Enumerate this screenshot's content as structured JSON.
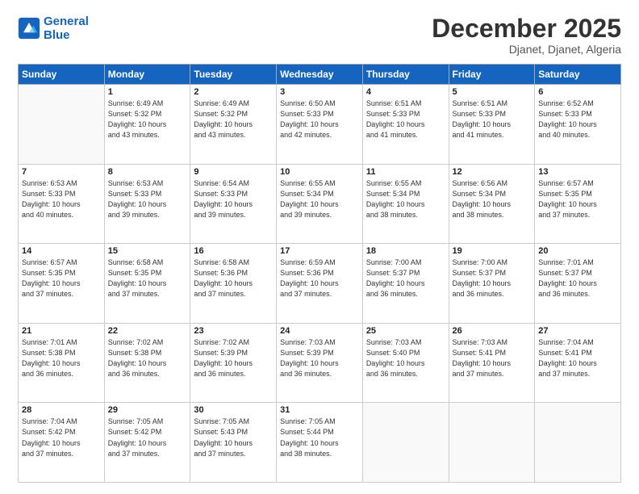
{
  "header": {
    "logo_line1": "General",
    "logo_line2": "Blue",
    "month": "December 2025",
    "location": "Djanet, Djanet, Algeria"
  },
  "weekdays": [
    "Sunday",
    "Monday",
    "Tuesday",
    "Wednesday",
    "Thursday",
    "Friday",
    "Saturday"
  ],
  "weeks": [
    [
      {
        "day": "",
        "info": ""
      },
      {
        "day": "1",
        "info": "Sunrise: 6:49 AM\nSunset: 5:32 PM\nDaylight: 10 hours\nand 43 minutes."
      },
      {
        "day": "2",
        "info": "Sunrise: 6:49 AM\nSunset: 5:32 PM\nDaylight: 10 hours\nand 43 minutes."
      },
      {
        "day": "3",
        "info": "Sunrise: 6:50 AM\nSunset: 5:33 PM\nDaylight: 10 hours\nand 42 minutes."
      },
      {
        "day": "4",
        "info": "Sunrise: 6:51 AM\nSunset: 5:33 PM\nDaylight: 10 hours\nand 41 minutes."
      },
      {
        "day": "5",
        "info": "Sunrise: 6:51 AM\nSunset: 5:33 PM\nDaylight: 10 hours\nand 41 minutes."
      },
      {
        "day": "6",
        "info": "Sunrise: 6:52 AM\nSunset: 5:33 PM\nDaylight: 10 hours\nand 40 minutes."
      }
    ],
    [
      {
        "day": "7",
        "info": "Sunrise: 6:53 AM\nSunset: 5:33 PM\nDaylight: 10 hours\nand 40 minutes."
      },
      {
        "day": "8",
        "info": "Sunrise: 6:53 AM\nSunset: 5:33 PM\nDaylight: 10 hours\nand 39 minutes."
      },
      {
        "day": "9",
        "info": "Sunrise: 6:54 AM\nSunset: 5:33 PM\nDaylight: 10 hours\nand 39 minutes."
      },
      {
        "day": "10",
        "info": "Sunrise: 6:55 AM\nSunset: 5:34 PM\nDaylight: 10 hours\nand 39 minutes."
      },
      {
        "day": "11",
        "info": "Sunrise: 6:55 AM\nSunset: 5:34 PM\nDaylight: 10 hours\nand 38 minutes."
      },
      {
        "day": "12",
        "info": "Sunrise: 6:56 AM\nSunset: 5:34 PM\nDaylight: 10 hours\nand 38 minutes."
      },
      {
        "day": "13",
        "info": "Sunrise: 6:57 AM\nSunset: 5:35 PM\nDaylight: 10 hours\nand 37 minutes."
      }
    ],
    [
      {
        "day": "14",
        "info": "Sunrise: 6:57 AM\nSunset: 5:35 PM\nDaylight: 10 hours\nand 37 minutes."
      },
      {
        "day": "15",
        "info": "Sunrise: 6:58 AM\nSunset: 5:35 PM\nDaylight: 10 hours\nand 37 minutes."
      },
      {
        "day": "16",
        "info": "Sunrise: 6:58 AM\nSunset: 5:36 PM\nDaylight: 10 hours\nand 37 minutes."
      },
      {
        "day": "17",
        "info": "Sunrise: 6:59 AM\nSunset: 5:36 PM\nDaylight: 10 hours\nand 37 minutes."
      },
      {
        "day": "18",
        "info": "Sunrise: 7:00 AM\nSunset: 5:37 PM\nDaylight: 10 hours\nand 36 minutes."
      },
      {
        "day": "19",
        "info": "Sunrise: 7:00 AM\nSunset: 5:37 PM\nDaylight: 10 hours\nand 36 minutes."
      },
      {
        "day": "20",
        "info": "Sunrise: 7:01 AM\nSunset: 5:37 PM\nDaylight: 10 hours\nand 36 minutes."
      }
    ],
    [
      {
        "day": "21",
        "info": "Sunrise: 7:01 AM\nSunset: 5:38 PM\nDaylight: 10 hours\nand 36 minutes."
      },
      {
        "day": "22",
        "info": "Sunrise: 7:02 AM\nSunset: 5:38 PM\nDaylight: 10 hours\nand 36 minutes."
      },
      {
        "day": "23",
        "info": "Sunrise: 7:02 AM\nSunset: 5:39 PM\nDaylight: 10 hours\nand 36 minutes."
      },
      {
        "day": "24",
        "info": "Sunrise: 7:03 AM\nSunset: 5:39 PM\nDaylight: 10 hours\nand 36 minutes."
      },
      {
        "day": "25",
        "info": "Sunrise: 7:03 AM\nSunset: 5:40 PM\nDaylight: 10 hours\nand 36 minutes."
      },
      {
        "day": "26",
        "info": "Sunrise: 7:03 AM\nSunset: 5:41 PM\nDaylight: 10 hours\nand 37 minutes."
      },
      {
        "day": "27",
        "info": "Sunrise: 7:04 AM\nSunset: 5:41 PM\nDaylight: 10 hours\nand 37 minutes."
      }
    ],
    [
      {
        "day": "28",
        "info": "Sunrise: 7:04 AM\nSunset: 5:42 PM\nDaylight: 10 hours\nand 37 minutes."
      },
      {
        "day": "29",
        "info": "Sunrise: 7:05 AM\nSunset: 5:42 PM\nDaylight: 10 hours\nand 37 minutes."
      },
      {
        "day": "30",
        "info": "Sunrise: 7:05 AM\nSunset: 5:43 PM\nDaylight: 10 hours\nand 37 minutes."
      },
      {
        "day": "31",
        "info": "Sunrise: 7:05 AM\nSunset: 5:44 PM\nDaylight: 10 hours\nand 38 minutes."
      },
      {
        "day": "",
        "info": ""
      },
      {
        "day": "",
        "info": ""
      },
      {
        "day": "",
        "info": ""
      }
    ]
  ]
}
